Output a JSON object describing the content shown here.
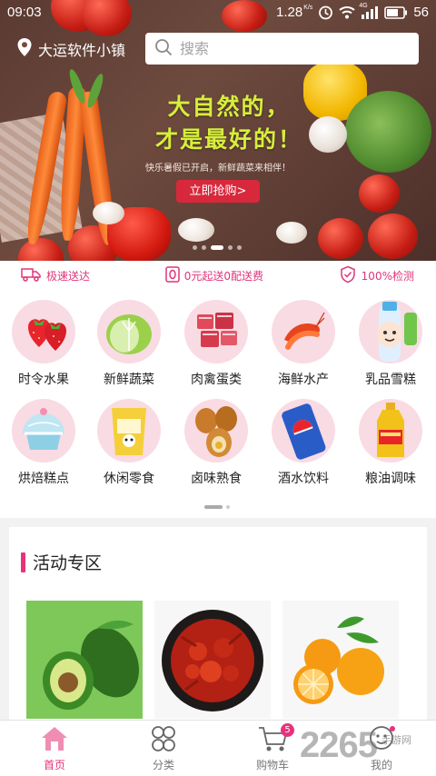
{
  "status_bar": {
    "time": "09:03",
    "speed": "1.28",
    "speed_unit": "K/s",
    "network": "4G",
    "battery": "56"
  },
  "header": {
    "location": "大运软件小镇",
    "search_placeholder": "搜索"
  },
  "banner": {
    "title_line1": "大自然的，",
    "title_line2": "才是最好的！",
    "subtitle": "快乐暑假已开启，新鲜蔬菜来相伴！",
    "cta_label": "立即抢购>"
  },
  "features": [
    {
      "label": "极速送达",
      "icon": "truck-icon"
    },
    {
      "label": "0元起送0配送费",
      "icon": "zero-fee-icon"
    },
    {
      "label": "100%检测",
      "icon": "shield-check-icon"
    }
  ],
  "categories": [
    {
      "label": "时令水果",
      "icon": "strawberry-icon"
    },
    {
      "label": "新鲜蔬菜",
      "icon": "cabbage-icon"
    },
    {
      "label": "肉禽蛋类",
      "icon": "meat-icon"
    },
    {
      "label": "海鲜水产",
      "icon": "shrimp-icon"
    },
    {
      "label": "乳品雪糕",
      "icon": "milk-bottle-icon"
    },
    {
      "label": "烘焙糕点",
      "icon": "cake-icon"
    },
    {
      "label": "休闲零食",
      "icon": "snack-bag-icon"
    },
    {
      "label": "卤味熟食",
      "icon": "braised-egg-icon"
    },
    {
      "label": "酒水饮料",
      "icon": "soda-can-icon"
    },
    {
      "label": "粮油调味",
      "icon": "oil-bottle-icon"
    }
  ],
  "activity": {
    "title": "活动专区",
    "products": [
      {
        "name": "avocado-product"
      },
      {
        "name": "crayfish-product"
      },
      {
        "name": "orange-product"
      }
    ]
  },
  "bottom_nav": {
    "items": [
      {
        "label": "首页",
        "icon": "home-icon",
        "active": true
      },
      {
        "label": "分类",
        "icon": "category-icon",
        "active": false
      },
      {
        "label": "购物车",
        "icon": "cart-icon",
        "active": false,
        "badge": "5"
      },
      {
        "label": "我的",
        "icon": "profile-icon",
        "active": false
      }
    ]
  },
  "watermark": {
    "logo": "2265",
    "caption": "手游网"
  },
  "colors": {
    "accent": "#e8327c",
    "cta": "#d8283c",
    "banner_title": "#d6ef3b"
  }
}
